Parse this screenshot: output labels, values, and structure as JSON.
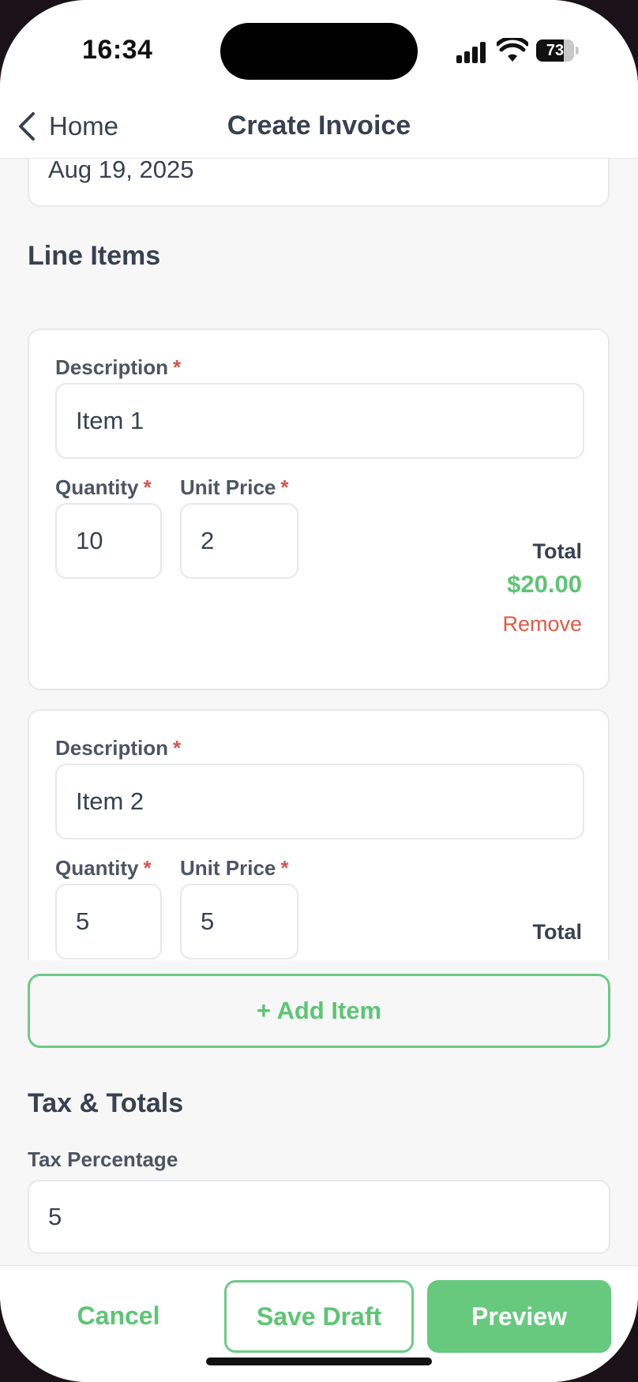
{
  "status_bar": {
    "time": "16:34",
    "battery": "73",
    "battery_level": 0.73
  },
  "nav": {
    "back_label": "Home",
    "title": "Create Invoice"
  },
  "date_field": {
    "value": "Aug 19, 2025"
  },
  "line_items_section": {
    "title": "Line Items"
  },
  "line_items": [
    {
      "description_label": "Description",
      "description": "Item 1",
      "quantity_label": "Quantity",
      "quantity": "10",
      "unit_price_label": "Unit Price",
      "unit_price": "2",
      "total_label": "Total",
      "total": "$20.00",
      "remove_label": "Remove"
    },
    {
      "description_label": "Description",
      "description": "Item 2",
      "quantity_label": "Quantity",
      "quantity": "5",
      "unit_price_label": "Unit Price",
      "unit_price": "5",
      "total_label": "Total"
    }
  ],
  "required_marker": "*",
  "add_item_label": "+ Add Item",
  "tax_section": {
    "title": "Tax & Totals",
    "tax_label": "Tax Percentage",
    "tax_value": "5"
  },
  "actions": {
    "cancel": "Cancel",
    "save_draft": "Save Draft",
    "preview": "Preview"
  },
  "colors": {
    "accent": "#5cc574",
    "danger": "#e05a47",
    "text": "#374151"
  }
}
